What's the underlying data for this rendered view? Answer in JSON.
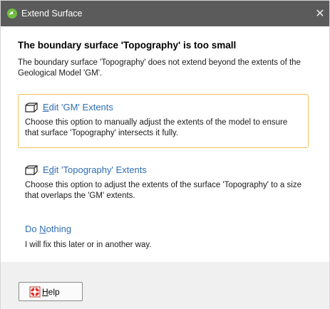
{
  "window": {
    "title": "Extend Surface",
    "close_glyph": "✕",
    "app_icon": "leapfrog-app-icon"
  },
  "heading": "The boundary surface 'Topography' is too small",
  "description": "The boundary surface 'Topography' does not extend beyond the extents of the Geological Model 'GM'.",
  "options": [
    {
      "icon": "box-extents-icon",
      "title_prefix": "",
      "title_underlined": "E",
      "title_rest": "dit 'GM' Extents",
      "description": "Choose this option to manually adjust the extents of the model to ensure that surface 'Topography' intersects it fully.",
      "focused": true
    },
    {
      "icon": "box-extents-icon",
      "title_prefix": "E",
      "title_underlined": "d",
      "title_rest": "it 'Topography' Extents",
      "description": "Choose this option to adjust the extents of the surface 'Topography' to a size that overlaps the 'GM' extents.",
      "focused": false
    },
    {
      "icon": "",
      "title_prefix": "Do ",
      "title_underlined": "N",
      "title_rest": "othing",
      "description": "I will fix this later or in another way.",
      "focused": false
    }
  ],
  "footer": {
    "help_underlined": "H",
    "help_rest": "elp",
    "help_icon": "lifebuoy-icon"
  },
  "colors": {
    "titlebar": "#5b5b5b",
    "link": "#2f6eb4",
    "focus_border": "#f0c15a",
    "footer_bg": "#f0f0f0"
  }
}
